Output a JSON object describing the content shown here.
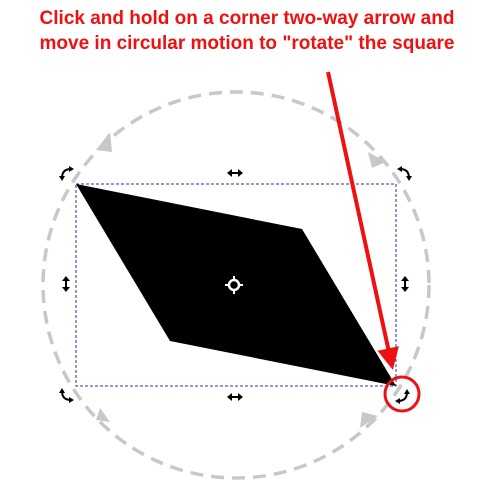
{
  "instruction": {
    "line1": "Click and hold on a corner two-way arrow and",
    "line2": "move in circular motion to \"rotate\" the square"
  },
  "colors": {
    "instruction_text": "#ee1111",
    "callout_arrow": "#ee1111",
    "rotation_path": "#c8c8c8",
    "bounding_box": "#3030a0",
    "shape_fill": "#000000",
    "handle": "#000000"
  },
  "icons": {
    "rotate_handles": [
      "rotate-arrow-icon",
      "rotate-arrow-icon",
      "rotate-arrow-icon",
      "rotate-arrow-icon"
    ],
    "skew_handles": [
      "skew-arrow-icon",
      "skew-arrow-icon",
      "skew-arrow-icon",
      "skew-arrow-icon"
    ],
    "center": "rotation-center-icon"
  }
}
